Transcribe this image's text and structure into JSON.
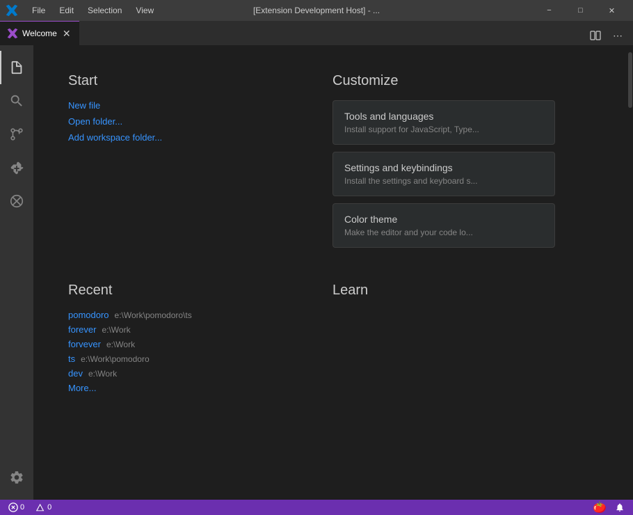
{
  "titleBar": {
    "title": "[Extension Development Host] - ...",
    "menus": [
      "File",
      "Edit",
      "Selection",
      "View"
    ],
    "logo": "vscode-logo"
  },
  "tabs": [
    {
      "id": "welcome",
      "icon": "vscode-icon",
      "label": "Welcome",
      "active": true
    }
  ],
  "tabActions": {
    "splitEditor": "⊞",
    "more": "···"
  },
  "activityBar": {
    "items": [
      {
        "id": "explorer",
        "icon": "files-icon",
        "active": true
      },
      {
        "id": "search",
        "icon": "search-icon",
        "active": false
      },
      {
        "id": "source-control",
        "icon": "source-control-icon",
        "active": false
      },
      {
        "id": "extensions",
        "icon": "extensions-icon",
        "active": false
      },
      {
        "id": "remote-explorer",
        "icon": "remote-icon",
        "active": false
      }
    ],
    "bottom": [
      {
        "id": "settings",
        "icon": "gear-icon"
      }
    ]
  },
  "welcome": {
    "start": {
      "title": "Start",
      "links": [
        {
          "label": "New file",
          "id": "new-file"
        },
        {
          "label": "Open folder...",
          "id": "open-folder"
        },
        {
          "label": "Add workspace folder...",
          "id": "add-workspace"
        }
      ]
    },
    "recent": {
      "title": "Recent",
      "items": [
        {
          "name": "pomodoro",
          "path": "e:\\Work\\pomodoro\\ts"
        },
        {
          "name": "forever",
          "path": "e:\\Work"
        },
        {
          "name": "forvever",
          "path": "e:\\Work"
        },
        {
          "name": "ts",
          "path": "e:\\Work\\pomodoro"
        },
        {
          "name": "dev",
          "path": "e:\\Work"
        }
      ],
      "moreLabel": "More..."
    },
    "customize": {
      "title": "Customize",
      "cards": [
        {
          "title": "Tools and languages",
          "desc": "Install support for JavaScript, Type..."
        },
        {
          "title": "Settings and keybindings",
          "desc": "Install the settings and keyboard s..."
        },
        {
          "title": "Color theme",
          "desc": "Make the editor and your code lo..."
        }
      ]
    },
    "learn": {
      "title": "Learn"
    }
  },
  "statusBar": {
    "left": [
      {
        "id": "errors",
        "icon": "error-icon",
        "text": "0"
      },
      {
        "id": "warnings",
        "icon": "warning-icon",
        "text": "0"
      }
    ],
    "right": [
      {
        "id": "tomato",
        "icon": "tomato-icon"
      },
      {
        "id": "bell",
        "icon": "bell-icon"
      }
    ]
  }
}
